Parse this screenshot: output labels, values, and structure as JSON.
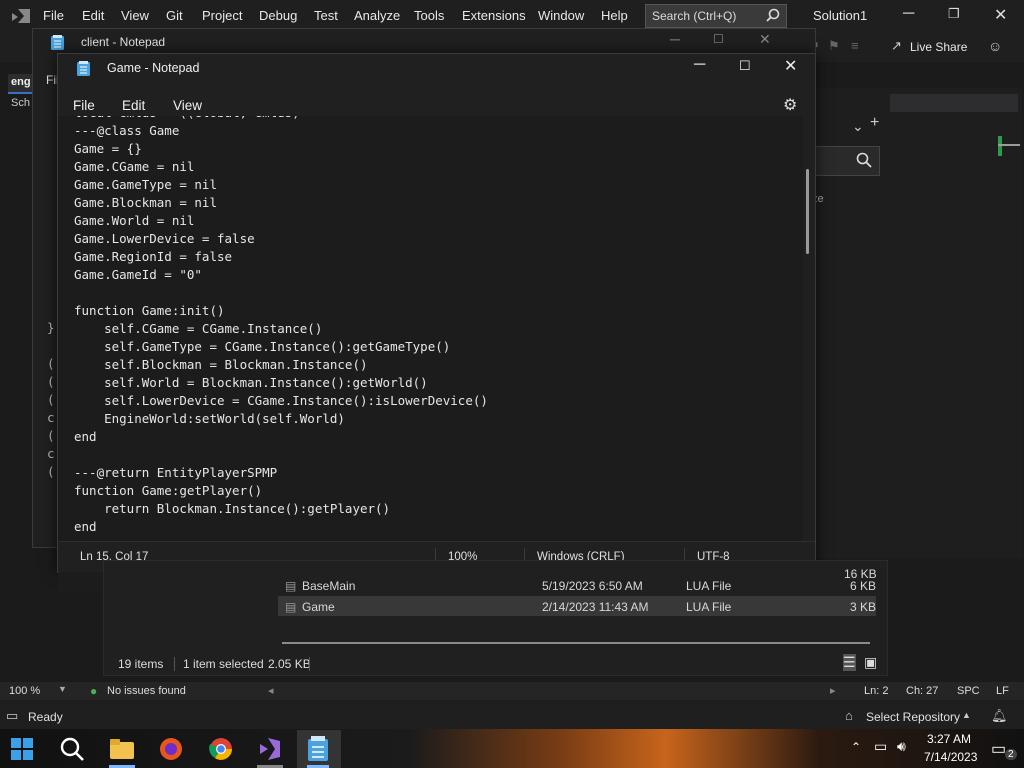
{
  "vs": {
    "menu": [
      "File",
      "Edit",
      "View",
      "Git",
      "Project",
      "Debug",
      "Test",
      "Analyze",
      "Tools",
      "Extensions",
      "Window",
      "Help"
    ],
    "search_placeholder": "Search (Ctrl+Q)",
    "solution": "Solution1",
    "live_share": "Live Share",
    "left_tab": "eng",
    "left_item": "Sch",
    "status_zoom": "100 %",
    "status_issues": "No issues found",
    "status_ln": "Ln: 2",
    "status_ch": "Ch: 27",
    "status_spc": "SPC",
    "status_lf": "LF",
    "ready": "Ready",
    "select_repo": "Select Repository",
    "notif_count": "2",
    "partial_text": "ze"
  },
  "explorer": {
    "rows": [
      {
        "name": "",
        "date": "",
        "type": "",
        "size": "16 KB"
      },
      {
        "name": "BaseMain",
        "date": "5/19/2023 6:50 AM",
        "type": "LUA File",
        "size": "6 KB"
      },
      {
        "name": "Game",
        "date": "2/14/2023 11:43 AM",
        "type": "LUA File",
        "size": "3 KB"
      }
    ],
    "status_items": "19 items",
    "status_selected": "1 item selected",
    "status_size": "2.05 KB"
  },
  "client_window": {
    "title": "client - Notepad",
    "menu_partial": "Fil"
  },
  "game_window": {
    "title": "Game - Notepad",
    "menu": [
      "File",
      "Edit",
      "View"
    ],
    "code": "local Gmlds = ((Global, Gmlds)\n---@class Game\nGame = {}\nGame.CGame = nil\nGame.GameType = nil\nGame.Blockman = nil\nGame.World = nil\nGame.LowerDevice = false\nGame.RegionId = false\nGame.GameId = \"0\"\n\nfunction Game:init()\n    self.CGame = CGame.Instance()\n    self.GameType = CGame.Instance():getGameType()\n    self.Blockman = Blockman.Instance()\n    self.World = Blockman.Instance():getWorld()\n    self.LowerDevice = CGame.Instance():isLowerDevice()\n    EngineWorld:setWorld(self.World)\nend\n\n---@return EntityPlayerSPMP\nfunction Game:getPlayer()\n    return Blockman.Instance():getPlayer()\nend",
    "status": {
      "pos": "Ln 15, Col 17",
      "zoom": "100%",
      "eol": "Windows (CRLF)",
      "enc": "UTF-8"
    }
  },
  "clock": {
    "time": "3:27 AM",
    "date": "7/14/2023"
  }
}
